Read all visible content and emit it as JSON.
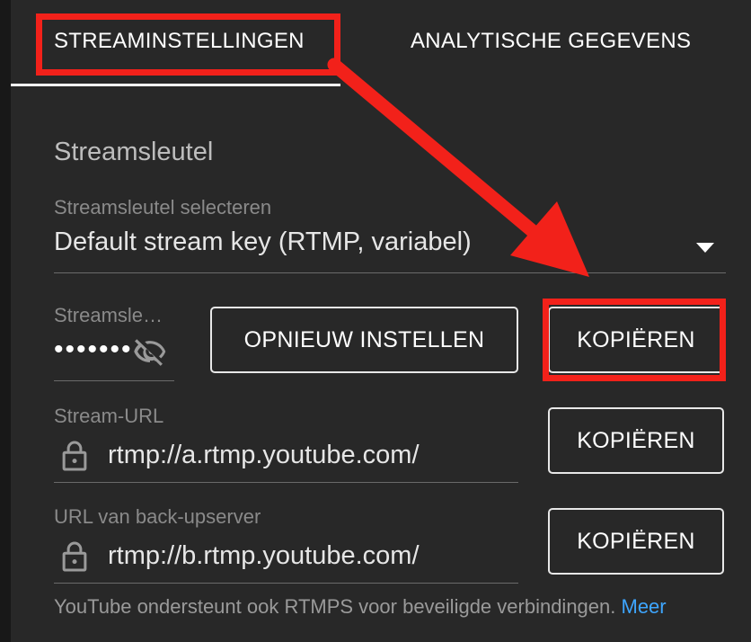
{
  "tabs": [
    {
      "label": "STREAMINSTELLINGEN",
      "active": true
    },
    {
      "label": "ANALYTISCHE GEGEVENS",
      "active": false
    }
  ],
  "stream_key_section": {
    "title": "Streamsleutel",
    "select_label": "Streamsleutel selecteren",
    "select_value": "Default stream key (RTMP, variabel)",
    "key_label": "Streamsle…",
    "key_value": "•••••••",
    "reset_button": "OPNIEUW INSTELLEN",
    "copy_button": "KOPIËREN"
  },
  "stream_url": {
    "label": "Stream-URL",
    "value": "rtmp://a.rtmp.youtube.com/",
    "copy_button": "KOPIËREN"
  },
  "backup_url": {
    "label": "URL van back-upserver",
    "value": "rtmp://b.rtmp.youtube.com/",
    "copy_button": "KOPIËREN"
  },
  "footer": {
    "text": "YouTube ondersteunt ook RTMPS voor beveiligde verbindingen.",
    "link": "Meer"
  },
  "icons": {
    "visibility": "eye-off-icon",
    "lock": "lock-icon",
    "dropdown": "caret-down-icon"
  },
  "colors": {
    "annotation_red": "#f2211a",
    "link_blue": "#3ea6ff",
    "panel_bg": "#282828"
  }
}
